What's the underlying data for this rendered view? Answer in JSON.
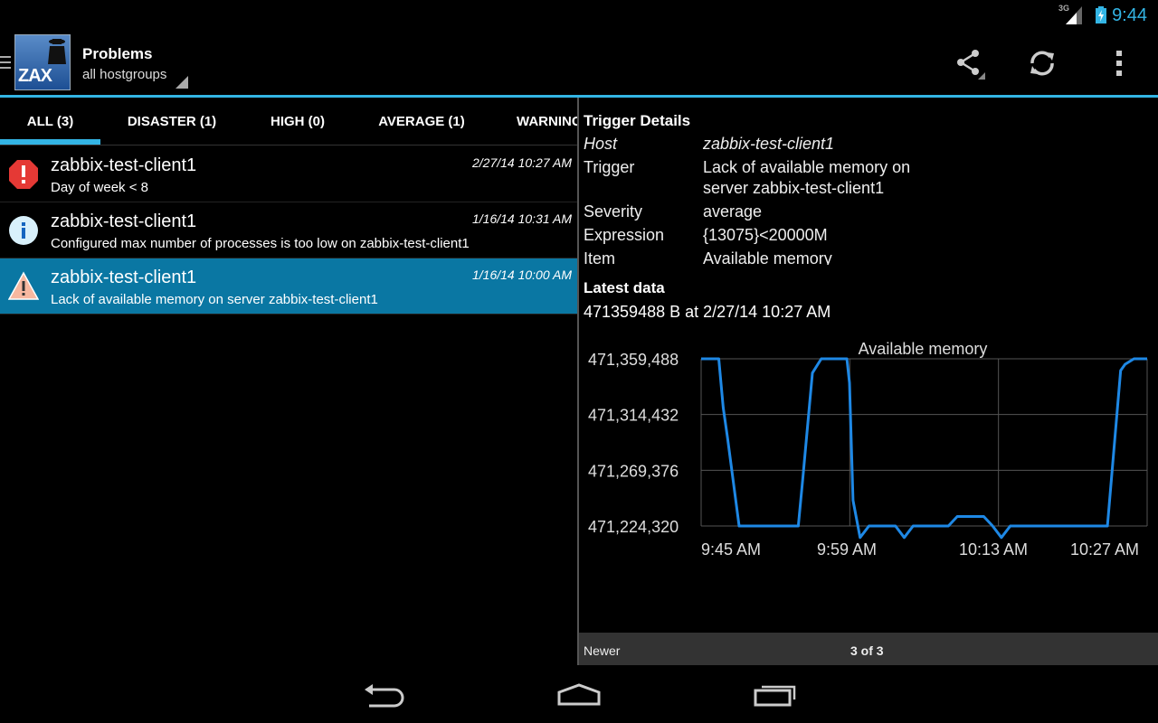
{
  "status_bar": {
    "network": "3G",
    "time": "9:44"
  },
  "action_bar": {
    "app_logo_text": "ZAX",
    "title": "Problems",
    "subtitle": "all hostgroups",
    "actions": [
      {
        "icon": "share-icon"
      },
      {
        "icon": "refresh-icon"
      },
      {
        "icon": "overflow-menu-icon"
      }
    ]
  },
  "tabs": [
    {
      "label": "ALL (3)",
      "selected": true
    },
    {
      "label": "DISASTER (1)"
    },
    {
      "label": "HIGH (0)"
    },
    {
      "label": "AVERAGE (1)"
    },
    {
      "label": "WARNING"
    }
  ],
  "problems": [
    {
      "host": "zabbix-test-client1",
      "description": "Day of week < 8",
      "time": "2/27/14 10:27 AM",
      "severity_icon": "disaster-icon",
      "severity_color": "#e53935"
    },
    {
      "host": "zabbix-test-client1",
      "description": "Configured max number of processes is too low on zabbix-test-client1",
      "time": "1/16/14 10:31 AM",
      "severity_icon": "info-icon",
      "severity_color": "#d8f0fb"
    },
    {
      "host": "zabbix-test-client1",
      "description": "Lack of available memory on server zabbix-test-client1",
      "time": "1/16/14 10:00 AM",
      "severity_icon": "warning-icon",
      "severity_color": "#f7b8a0",
      "selected": true
    }
  ],
  "details": {
    "heading": "Trigger Details",
    "host_label": "Host",
    "host_value": "zabbix-test-client1",
    "trigger_label": "Trigger",
    "trigger_value_line1": "Lack of available memory on",
    "trigger_value_line2": "server zabbix-test-client1",
    "severity_label": "Severity",
    "severity_value": "average",
    "expression_label": "Expression",
    "expression_value": "{13075}<20000M",
    "item_label": "Item",
    "item_value": "Available memory",
    "latest_heading": "Latest data",
    "latest_value": "471359488 B at 2/27/14 10:27 AM"
  },
  "chart_data": {
    "type": "line",
    "title": "Available memory",
    "y_ticks": [
      "471,359,488",
      "471,314,432",
      "471,269,376",
      "471,224,320"
    ],
    "x_ticks": [
      "9:45 AM",
      "9:59 AM",
      "10:13 AM",
      "10:27 AM"
    ],
    "ylim": [
      471224320,
      471359488
    ],
    "line_color": "#1e88e5",
    "grid": true,
    "series": [
      {
        "x": [
          0,
          2,
          2.5,
          3,
          4.3,
          11,
          11.5,
          12.6,
          13.6,
          13.9,
          16,
          16.5,
          16.8,
          17.2,
          18,
          19,
          21,
          22,
          23,
          24,
          25,
          27,
          28,
          29,
          31,
          32,
          33,
          34,
          35,
          37,
          38,
          39,
          40,
          46,
          47.5,
          48,
          49,
          50.5
        ],
        "y": [
          471359488,
          471359488,
          471320000,
          471295000,
          471224320,
          471224320,
          471262000,
          471348000,
          471359488,
          471359488,
          471359488,
          471359488,
          471340000,
          471245000,
          471215000,
          471224320,
          471224320,
          471224320,
          471215000,
          471224320,
          471224320,
          471224320,
          471224320,
          471232000,
          471232000,
          471232000,
          471224320,
          471215000,
          471224320,
          471224320,
          471224320,
          471224320,
          471224320,
          471224320,
          471350000,
          471355000,
          471359488,
          471359488
        ]
      }
    ]
  },
  "pager": {
    "newer_label": "Newer",
    "page_label": "3 of 3"
  }
}
